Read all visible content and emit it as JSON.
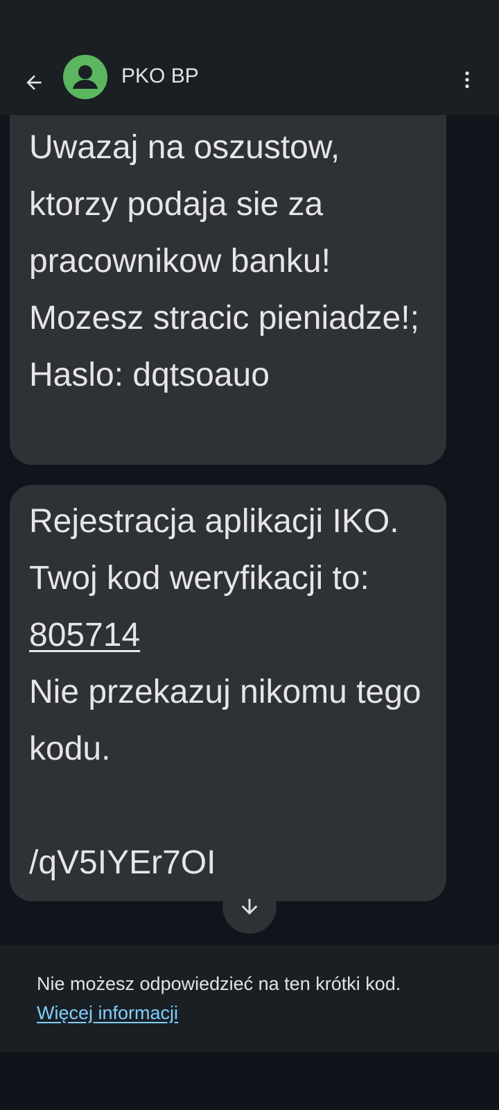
{
  "header": {
    "contact_name": "PKO BP",
    "avatar_color": "#5cb55f",
    "back_icon": "arrow-left-icon",
    "more_icon": "more-vertical-icon"
  },
  "messages": [
    {
      "text": "Uwazaj na oszustow, ktorzy podaja sie za pracownikow banku! Mozesz stracic pieniadze!; Haslo: dqtsoauo"
    },
    {
      "text_before_code": "Rejestracja aplikacji IKO. Twoj kod weryfikacji to: ",
      "code": "805714",
      "text_after_code": "\nNie przekazuj nikomu tego kodu.\n\n/qV5IYEr7OI"
    }
  ],
  "scroll_button": {
    "icon": "arrow-down-icon"
  },
  "footer": {
    "info_text": "Nie możesz odpowiedzieć na ten krótki kod.",
    "link_text": "Więcej informacji",
    "link_color": "#7fcfff"
  },
  "colors": {
    "background": "#10151b",
    "bar": "#1a1f24",
    "bubble": "#2e3135",
    "text": "#e6e6e6"
  }
}
